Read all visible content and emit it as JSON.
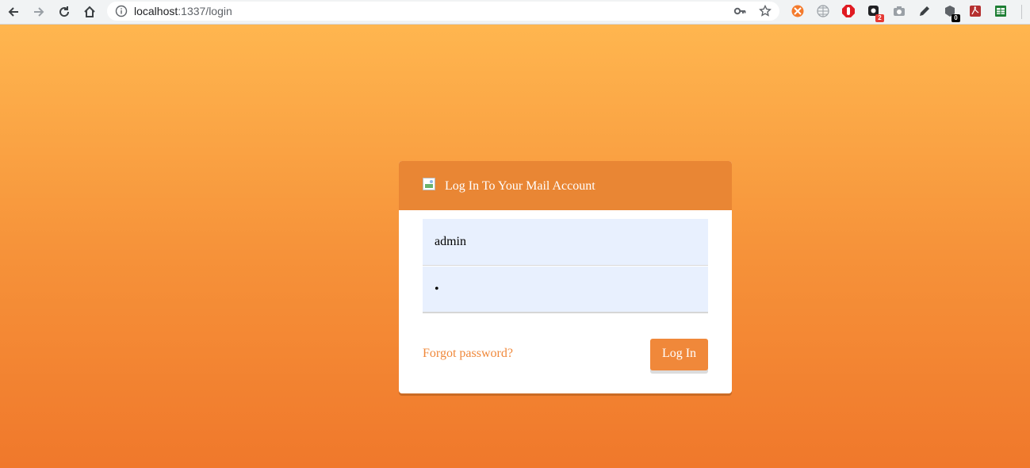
{
  "browser": {
    "url_host": "localhost",
    "url_rest": ":1337/login",
    "extensions": [
      {
        "name": "ext-orange-icon"
      },
      {
        "name": "ext-grid-icon"
      },
      {
        "name": "ext-hand-icon"
      },
      {
        "name": "ext-dark-icon",
        "badge": "2"
      },
      {
        "name": "ext-camera-icon"
      },
      {
        "name": "ext-pencil-icon"
      },
      {
        "name": "ext-box-icon",
        "badge": "0"
      },
      {
        "name": "ext-pdf-icon"
      },
      {
        "name": "ext-sheet-icon"
      }
    ]
  },
  "login": {
    "title": "Log In To Your Mail Account",
    "username_value": "admin",
    "password_value": "•",
    "forgot_label": "Forgot password?",
    "submit_label": "Log In"
  },
  "colors": {
    "accent": "#f0883a",
    "header": "#e98634",
    "field_bg": "#e8f0fe"
  }
}
